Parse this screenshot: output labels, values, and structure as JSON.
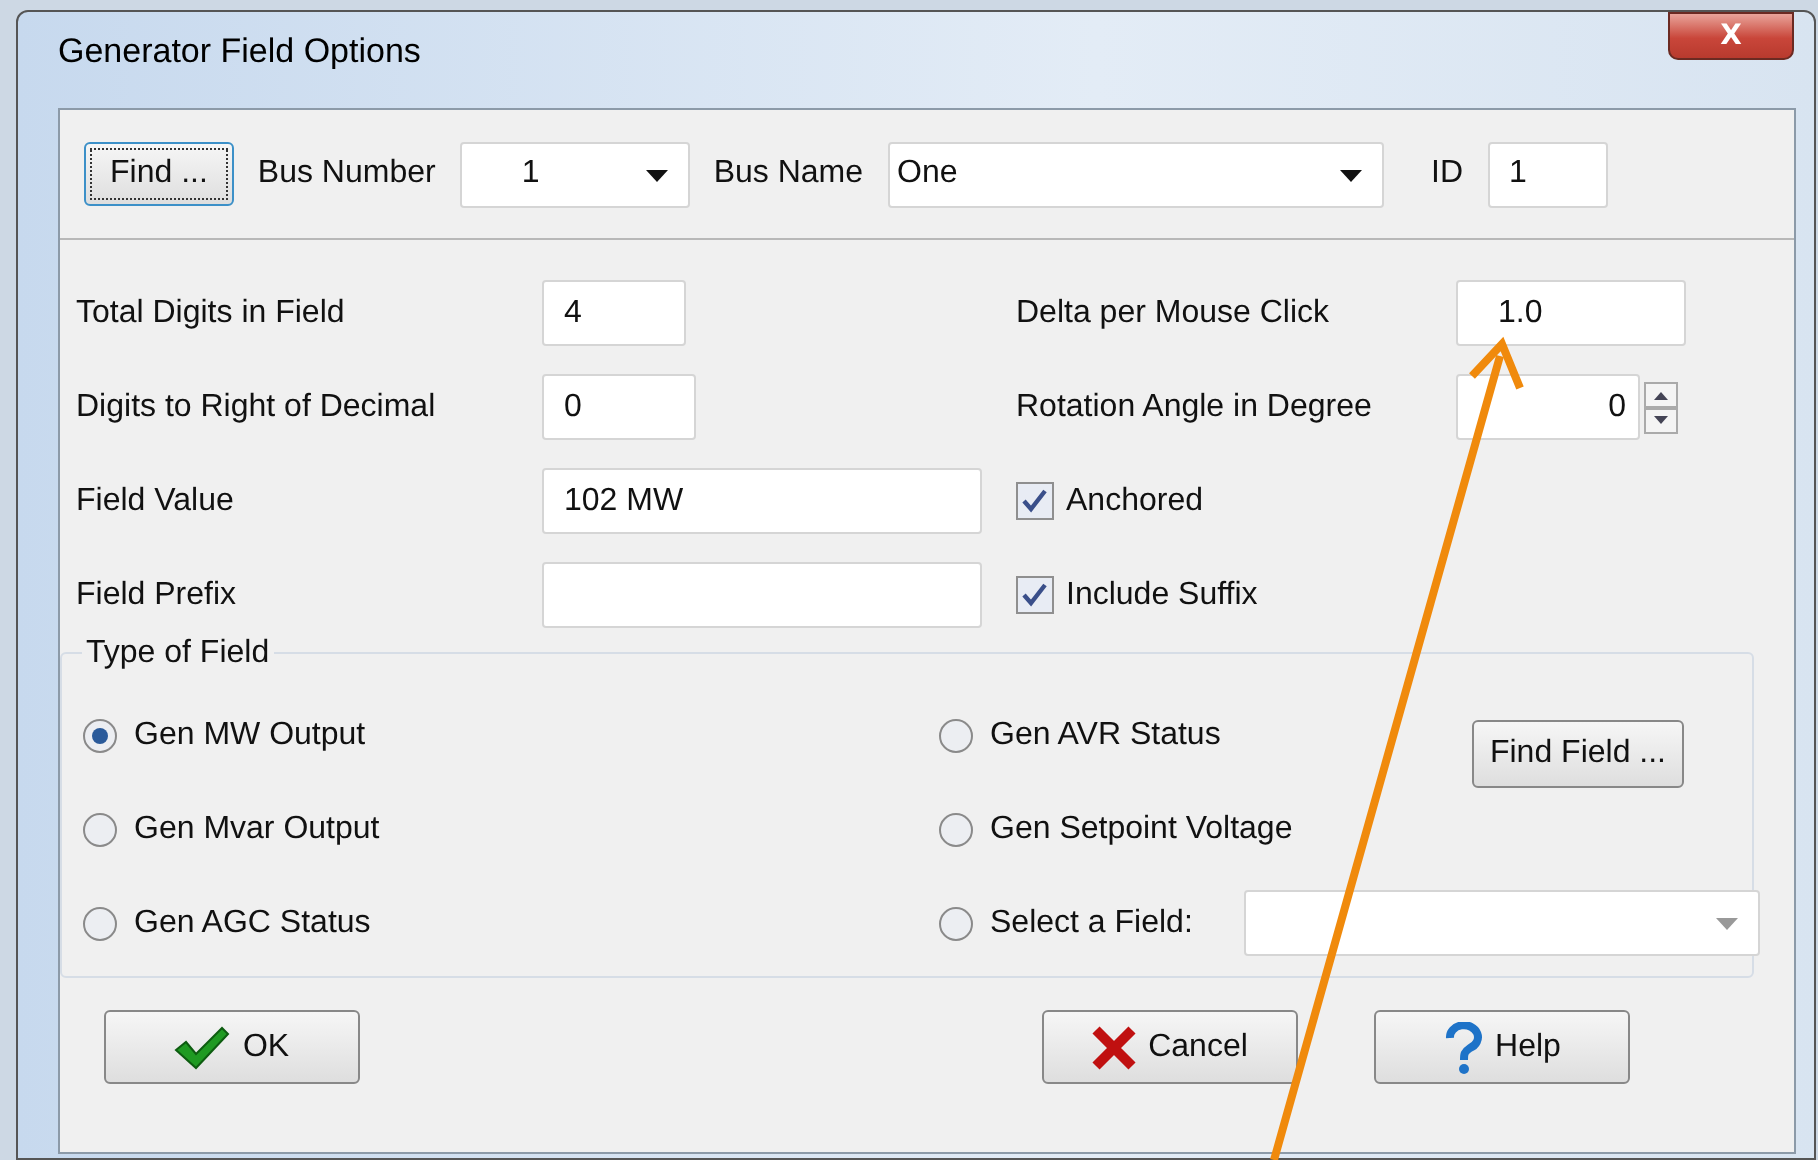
{
  "window": {
    "title": "Generator Field Options",
    "close": "X"
  },
  "bus": {
    "find_button": "Find ...",
    "number_label": "Bus Number",
    "number_value": "1",
    "name_label": "Bus Name",
    "name_value": "One",
    "id_label": "ID",
    "id_value": "1"
  },
  "left_fields": [
    {
      "label": "Total Digits in Field",
      "value": "4"
    },
    {
      "label": "Digits to Right of Decimal",
      "value": "0"
    },
    {
      "label": "Field Value",
      "value": "102 MW"
    },
    {
      "label": "Field Prefix"
    }
  ],
  "delta": {
    "label": "Delta per Mouse Click",
    "value": "1.0"
  },
  "rotation": {
    "label": "Rotation Angle in Degree",
    "value": "0"
  },
  "checkboxes": [
    {
      "label": "Anchored",
      "checked": true
    },
    {
      "label": "Include Suffix",
      "checked": true
    }
  ],
  "type_of_field": {
    "title": "Type of Field",
    "find_field_button": "Find Field ...",
    "options": [
      {
        "label": "Gen MW Output",
        "selected": true,
        "kind": "plain"
      },
      {
        "label": "Gen AVR Status",
        "selected": false,
        "kind": "plain"
      },
      {
        "label": "Gen Mvar Output",
        "selected": false,
        "kind": "plain"
      },
      {
        "label": "Gen Setpoint Voltage",
        "selected": false,
        "kind": "plain"
      },
      {
        "label": "Gen AGC Status",
        "selected": false,
        "kind": "plain"
      },
      {
        "label": "Select a Field:",
        "selected": false,
        "kind": "combo"
      }
    ]
  },
  "buttons": [
    {
      "label": "OK",
      "kind": "ok"
    },
    {
      "label": "Cancel",
      "kind": "cancel"
    },
    {
      "label": "Help",
      "kind": "help"
    }
  ]
}
